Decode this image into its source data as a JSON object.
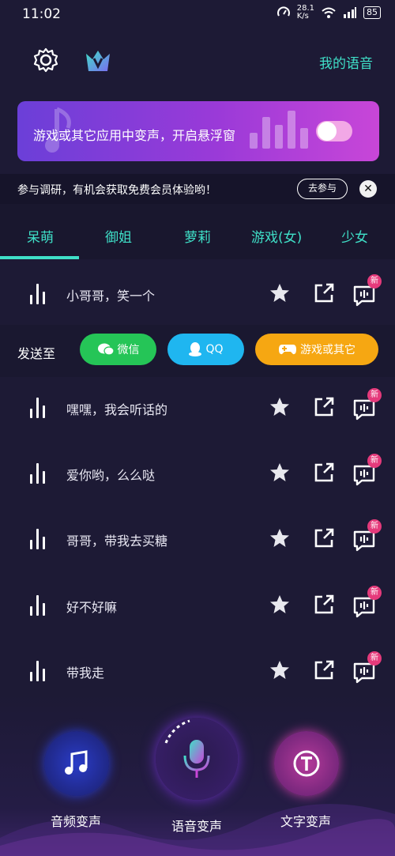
{
  "status_bar": {
    "time": "11:02",
    "speed": "28.1\nK/s",
    "battery": "85"
  },
  "header": {
    "my_voice": "我的语音"
  },
  "banner": {
    "text": "游戏或其它应用中变声，开启悬浮窗"
  },
  "survey": {
    "text": "参与调研，有机会获取免费会员体验哟！",
    "button": "去参与"
  },
  "tabs": [
    {
      "label": "呆萌",
      "selected": true
    },
    {
      "label": "御姐",
      "selected": false
    },
    {
      "label": "萝莉",
      "selected": false
    },
    {
      "label": "游戏(女)",
      "selected": false
    },
    {
      "label": "少女",
      "selected": false
    }
  ],
  "send_to": {
    "label": "发送至",
    "wechat": "微信",
    "qq": "QQ",
    "games": "游戏或其它"
  },
  "voice_items": [
    {
      "title": "小哥哥，笑一个",
      "badge": "新"
    },
    {
      "title": "嘿嘿，我会听话的",
      "badge": "新"
    },
    {
      "title": "爱你哟，么么哒",
      "badge": "新"
    },
    {
      "title": "哥哥，带我去买糖",
      "badge": "新"
    },
    {
      "title": "好不好嘛",
      "badge": "新"
    },
    {
      "title": "带我走",
      "badge": "新"
    }
  ],
  "bottom_nav": {
    "audio": "音频变声",
    "voice": "语音变声",
    "text": "文字变声"
  },
  "colors": {
    "accent": "#3fe0c8",
    "wechat": "#25c557",
    "qq": "#1fb6f0",
    "games": "#f6a712",
    "badge": "#e53a7b"
  }
}
